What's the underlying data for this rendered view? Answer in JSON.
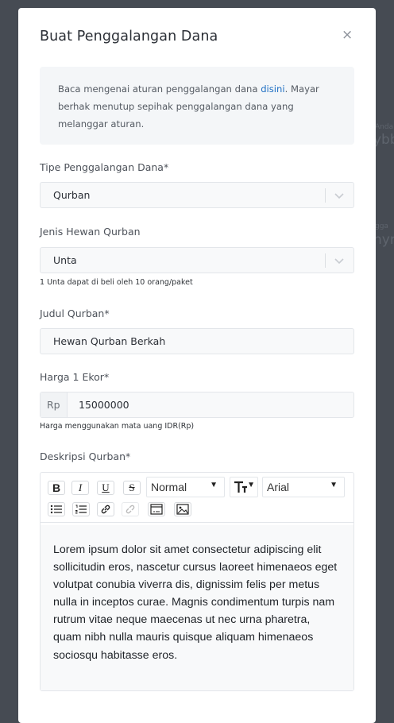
{
  "background": {
    "text1": "Anda",
    "text2": "ybb",
    "text3": "gga",
    "text4": "hyr"
  },
  "modal": {
    "title": "Buat Penggalangan Dana",
    "close_symbol": "×",
    "info": {
      "text_before": "Baca mengenai aturan penggalangan dana ",
      "link": "disini",
      "text_after": ". Mayar berhak menutup sepihak penggalangan dana yang melanggar aturan."
    },
    "fields": {
      "tipe": {
        "label": "Tipe Penggalangan Dana*",
        "value": "Qurban"
      },
      "jenis": {
        "label": "Jenis Hewan Qurban",
        "value": "Unta",
        "hint": "1 Unta dapat di beli oleh 10 orang/paket"
      },
      "judul": {
        "label": "Judul Qurban*",
        "value": "Hewan Qurban Berkah"
      },
      "harga": {
        "label": "Harga 1 Ekor*",
        "prefix": "Rp",
        "value": "15000000",
        "hint": "Harga menggunakan mata uang IDR(Rp)"
      },
      "deskripsi": {
        "label": "Deskripsi Qurban*",
        "toolbar": {
          "bold": "B",
          "italic": "I",
          "underline": "U",
          "strike": "S",
          "format": "Normal",
          "font": "Arial"
        },
        "content": "Lorem ipsum dolor sit amet consectetur adipiscing elit sollicitudin eros, nascetur cursus laoreet himenaeos eget volutpat conubia viverra dis, dignissim felis per metus nulla in inceptos curae. Magnis condimentum turpis nam rutrum vitae neque maecenas ut nec urna pharetra, quam nibh nulla mauris quisque aliquam himenaeos sociosqu habitasse eros."
      }
    }
  }
}
